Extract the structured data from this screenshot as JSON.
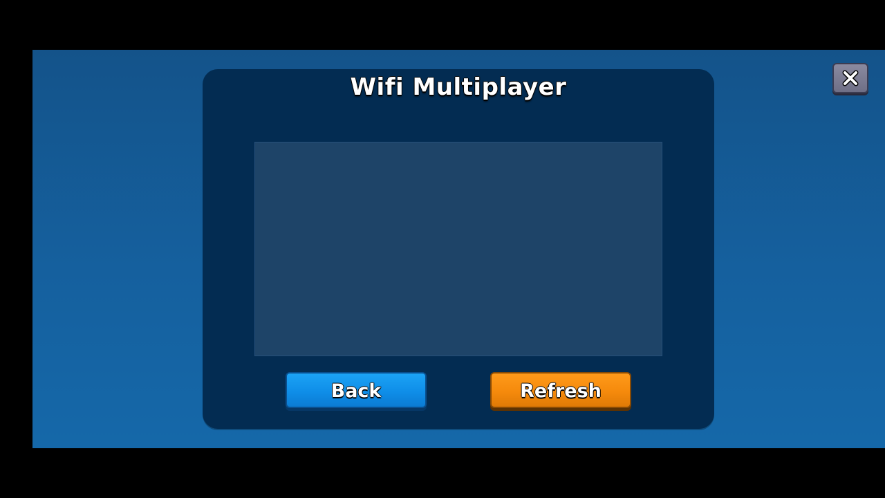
{
  "dialog": {
    "title": "Wifi Multiplayer"
  },
  "buttons": {
    "back_label": "Back",
    "refresh_label": "Refresh"
  },
  "icons": {
    "close": "close-icon"
  },
  "colors": {
    "back_button": "#0f8ee8",
    "refresh_button": "#f58a0c",
    "dialog_background": "#032c52",
    "list_background": "#1e4468"
  }
}
